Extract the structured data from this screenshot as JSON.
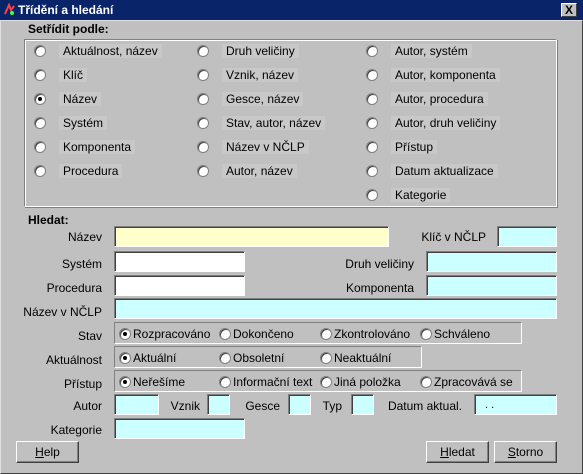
{
  "window": {
    "title": "Třídění a hledání",
    "close_label": "X"
  },
  "sort": {
    "title": "Setřídit podle:",
    "options": [
      {
        "label": "Aktuálnost, název",
        "checked": false
      },
      {
        "label": "Klíč",
        "checked": false
      },
      {
        "label": "Název",
        "checked": true
      },
      {
        "label": "Systém",
        "checked": false
      },
      {
        "label": "Komponenta",
        "checked": false
      },
      {
        "label": "Procedura",
        "checked": false
      },
      {
        "label": "Druh veličiny",
        "checked": false
      },
      {
        "label": "Vznik, název",
        "checked": false
      },
      {
        "label": "Gesce, název",
        "checked": false
      },
      {
        "label": "Stav, autor, název",
        "checked": false
      },
      {
        "label": "Název v NČLP",
        "checked": false
      },
      {
        "label": "Autor, název",
        "checked": false
      },
      {
        "label": "Autor, systém",
        "checked": false
      },
      {
        "label": "Autor, komponenta",
        "checked": false
      },
      {
        "label": "Autor, procedura",
        "checked": false
      },
      {
        "label": "Autor, druh veličiny",
        "checked": false
      },
      {
        "label": "Přístup",
        "checked": false
      },
      {
        "label": "Datum aktualizace",
        "checked": false
      },
      {
        "label": "Kategorie",
        "checked": false
      }
    ]
  },
  "search": {
    "title": "Hledat:",
    "nazev_label": "Název",
    "nazev_value": "",
    "klic_label": "Klíč v NČLP",
    "klic_value": "",
    "system_label": "Systém",
    "system_value": "",
    "druh_label": "Druh veličiny",
    "druh_value": "",
    "procedura_label": "Procedura",
    "procedura_value": "",
    "komponenta_label": "Komponenta",
    "komponenta_value": "",
    "nazev_nclp_label": "Název v NČLP",
    "nazev_nclp_value": "",
    "stav_label": "Stav",
    "stav_options": [
      {
        "label": "Rozpracováno",
        "checked": true
      },
      {
        "label": "Dokončeno",
        "checked": false
      },
      {
        "label": "Zkontrolováno",
        "checked": false
      },
      {
        "label": "Schváleno",
        "checked": false
      }
    ],
    "aktualnost_label": "Aktuálnost",
    "aktualnost_options": [
      {
        "label": "Aktuální",
        "checked": true
      },
      {
        "label": "Obsoletní",
        "checked": false
      },
      {
        "label": "Neaktuální",
        "checked": false
      }
    ],
    "pristup_label": "Přístup",
    "pristup_options": [
      {
        "label": "Neřešíme",
        "checked": true
      },
      {
        "label": "Informační text",
        "checked": false
      },
      {
        "label": "Jiná položka",
        "checked": false
      },
      {
        "label": "Zpracovává se",
        "checked": false
      }
    ],
    "autor_label": "Autor",
    "autor_value": "",
    "vznik_label": "Vznik",
    "vznik_value": "",
    "gesce_label": "Gesce",
    "gesce_value": "",
    "typ_label": "Typ",
    "typ_value": "",
    "datum_label": "Datum aktual.",
    "datum_value": ". .",
    "kategorie_label": "Kategorie",
    "kategorie_value": ""
  },
  "buttons": {
    "help_ul": "H",
    "help_rest": "elp",
    "hledat_ul": "H",
    "hledat_rest": "ledat",
    "storno_ul": "S",
    "storno_rest": "torno"
  },
  "colors": {
    "titlebar": "#0a246a",
    "dialog": "#c0c0c0",
    "field_cyan": "#ccffff",
    "field_yellow": "#ffffcc"
  }
}
